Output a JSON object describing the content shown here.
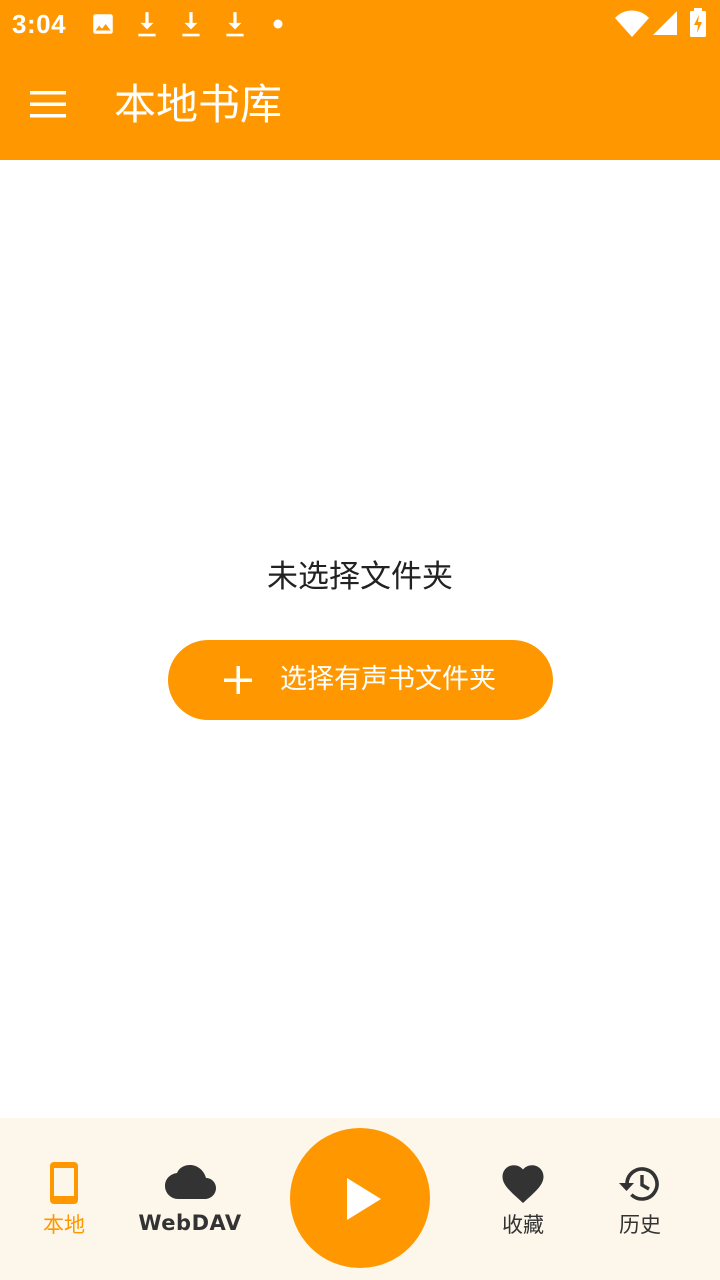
{
  "status_bar": {
    "time": "3:04",
    "notification_icons": [
      "image-icon",
      "download-icon",
      "download-icon",
      "download-icon",
      "dot-icon"
    ],
    "system_icons": [
      "wifi-icon",
      "signal-icon",
      "battery-charging-icon"
    ]
  },
  "app_bar": {
    "title": "本地书库",
    "menu_icon": "menu-icon"
  },
  "main": {
    "empty_text": "未选择文件夹",
    "pick_button_label": "选择有声书文件夹"
  },
  "bottom_nav": {
    "tabs": [
      {
        "label": "本地",
        "icon": "phone-icon",
        "active": true
      },
      {
        "label": "WebDAV",
        "icon": "cloud-icon",
        "active": false
      },
      {
        "label": "收藏",
        "icon": "heart-icon",
        "active": false
      },
      {
        "label": "历史",
        "icon": "history-icon",
        "active": false
      }
    ],
    "play_icon": "play-icon"
  },
  "colors": {
    "accent": "#FF9800",
    "bottom_bar_bg": "#FDF6EA",
    "text_dark": "#222222",
    "icon_dark": "#333333"
  }
}
